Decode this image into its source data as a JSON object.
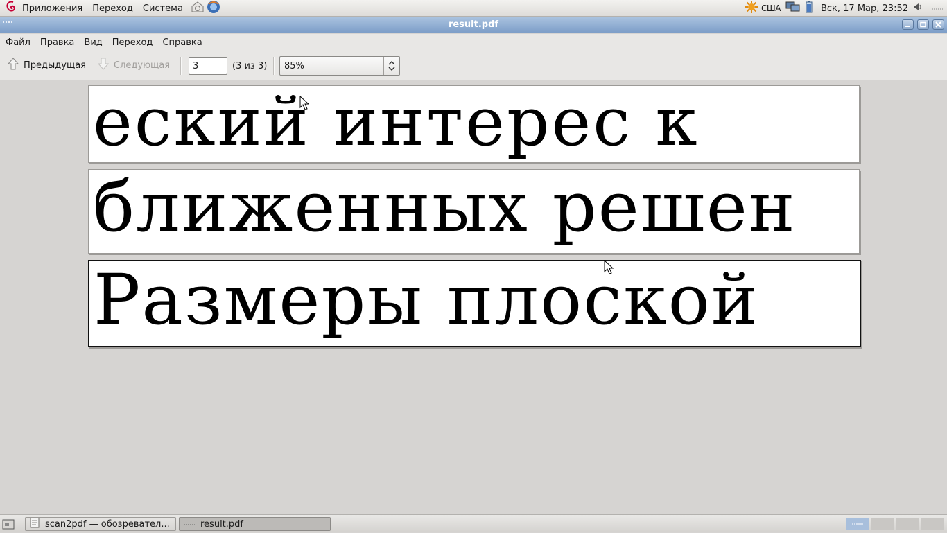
{
  "top_panel": {
    "menus": [
      "Приложения",
      "Переход",
      "Система"
    ],
    "keyboard_layout": "США",
    "clock": "Вск, 17 Мар, 23:52"
  },
  "window": {
    "title": "result.pdf"
  },
  "menubar": {
    "items": [
      {
        "label": "Файл"
      },
      {
        "label": "Правка"
      },
      {
        "label": "Вид"
      },
      {
        "label": "Переход"
      },
      {
        "label": "Справка"
      }
    ]
  },
  "toolbar": {
    "prev_label": "Предыдущая",
    "next_label": "Следующая",
    "page_value": "3",
    "page_count": "(3 из 3)",
    "zoom_value": "85%"
  },
  "document": {
    "pages": [
      {
        "text": "еский  интерес  к"
      },
      {
        "text": "ближенных  решен"
      },
      {
        "text": "Размеры  плоской"
      }
    ]
  },
  "taskbar": {
    "tasks": [
      {
        "label": "scan2pdf — обозревател...",
        "active": false
      },
      {
        "label": "result.pdf",
        "active": true
      }
    ]
  },
  "colors": {
    "titlebar": "#8eaacd",
    "desktop_bg": "#d6d4d2",
    "page_bg": "#ffffff"
  }
}
